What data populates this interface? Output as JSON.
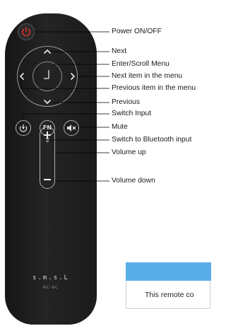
{
  "remote": {
    "brand": "s.m.s.L",
    "model": "RC-8C",
    "fn_label": "FN"
  },
  "callouts": [
    "Power ON/OFF",
    "Next",
    "Enter/Scroll Menu",
    "Next item in the menu",
    "Previous item in the menu",
    "Previous",
    "Switch Input",
    "Mute",
    "Switch to Bluetooth input",
    "Volume up",
    "Volume down"
  ],
  "popup": {
    "text": "This remote co",
    "bar_color": "#5aaee8"
  },
  "colors": {
    "remote_body": "#1e1e1e",
    "power_icon": "#d9342b",
    "leader_line": "#000000"
  },
  "icons": [
    "power-icon",
    "up-arrow-icon",
    "down-arrow-icon",
    "left-arrow-icon",
    "right-arrow-icon",
    "enter-icon",
    "input-icon",
    "mute-icon",
    "bluetooth-icon",
    "plus-icon",
    "minus-icon"
  ]
}
